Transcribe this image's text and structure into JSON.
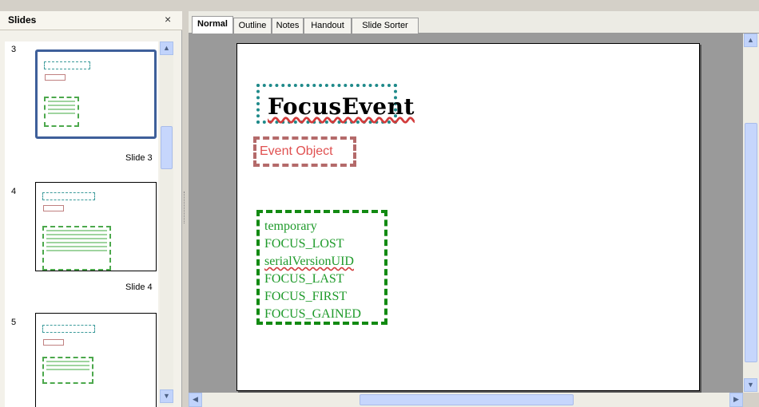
{
  "slides_pane": {
    "title": "Slides",
    "close_glyph": "×",
    "slides": [
      {
        "number": "3",
        "label": "Slide 3",
        "selected": true
      },
      {
        "number": "4",
        "label": "Slide 4",
        "selected": false
      },
      {
        "number": "5",
        "label": "",
        "selected": false
      }
    ]
  },
  "tabs": [
    {
      "label": "Normal",
      "active": true
    },
    {
      "label": "Outline",
      "active": false
    },
    {
      "label": "Notes",
      "active": false
    },
    {
      "label": "Handout",
      "active": false
    },
    {
      "label": "Slide Sorter",
      "active": false
    }
  ],
  "slide": {
    "title": "FocusEvent",
    "subtitle": "Event Object",
    "items": [
      "temporary",
      "FOCUS_LOST",
      "serialVersionUID",
      "FOCUS_LAST",
      "FOCUS_FIRST",
      "FOCUS_GAINED"
    ]
  },
  "icons": {
    "up": "▲",
    "down": "▼",
    "left": "◀",
    "right": "▶"
  },
  "colors": {
    "title_border": "#1f8a8a",
    "subtitle_border": "#b46a6a",
    "list_border": "#128a12",
    "list_text": "#1e9a2a",
    "subtitle_text": "#e05050",
    "selection_border": "#3e5f9a"
  }
}
